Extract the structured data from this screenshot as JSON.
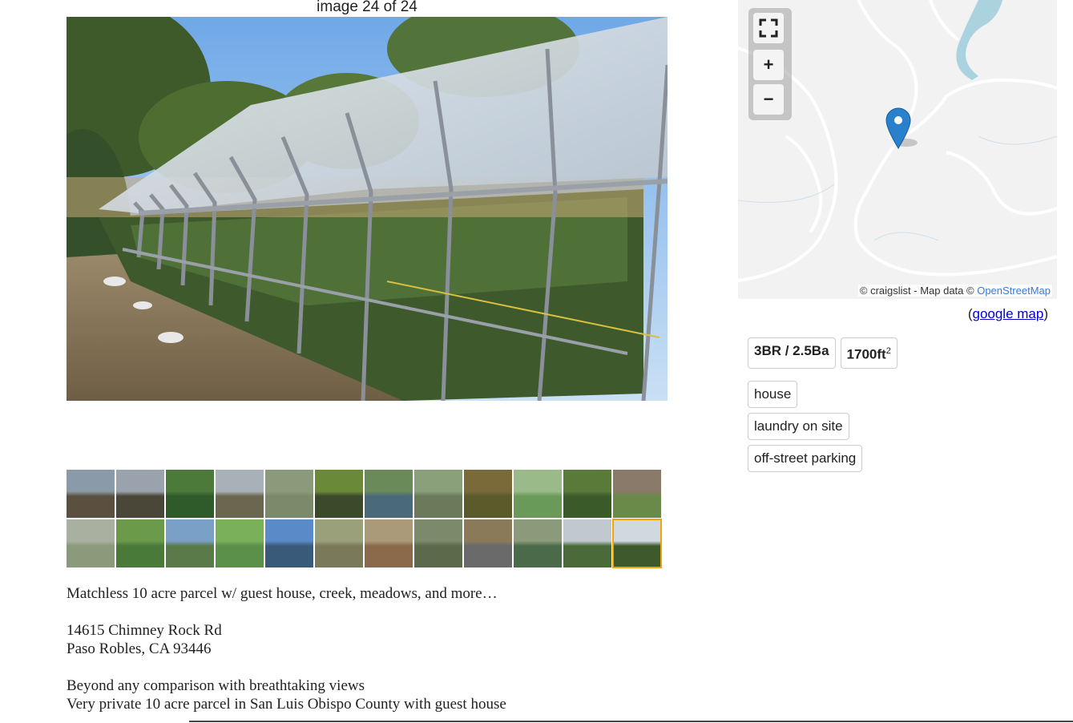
{
  "gallery": {
    "counter": "image 24 of 24",
    "thumbs_count": 24,
    "selected_index": 23
  },
  "map": {
    "attribution_prefix": "© craigslist - Map data © ",
    "attribution_link": "OpenStreetMap",
    "fullscreen_icon": "fullscreen-icon",
    "zoom_in": "+",
    "zoom_out": "−",
    "google_map_open": "(",
    "google_map_label": "google map",
    "google_map_close": ")"
  },
  "housing": {
    "br_ba": "3BR / 2.5Ba",
    "sqft": "1700ft",
    "sqft_sup": "2"
  },
  "attributes": [
    "house",
    "laundry on site",
    "off-street parking"
  ],
  "body": {
    "line1": "Matchless 10 acre parcel w/ guest house, creek, meadows, and more…",
    "address1": "14615 Chimney Rock Rd",
    "address2": "Paso Robles, CA 93446",
    "line4": "Beyond any comparison with breathtaking views",
    "line5": "Very private 10 acre parcel in San Luis Obispo County with guest house"
  },
  "colors": {
    "thumb_selected": "#f5a300",
    "link": "#0000cc",
    "osm_link": "#3a7bd5",
    "marker": "#2a81cb"
  }
}
